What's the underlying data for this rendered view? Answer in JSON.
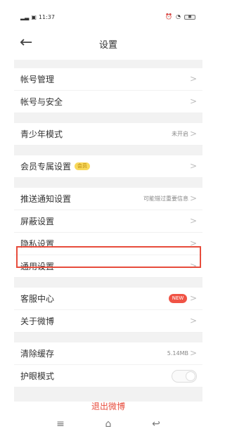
{
  "status_bar": {
    "time": "11:37",
    "signal_icon": "signal-icon",
    "sim_icon": "sim-icon",
    "alarm_icon": "alarm-icon",
    "wifi_icon": "wifi-icon",
    "battery_icon": "battery-icon"
  },
  "nav": {
    "back_label": "←",
    "title": "设置"
  },
  "groups": [
    {
      "items": [
        {
          "label": "帐号管理",
          "value": "",
          "chevron": ">"
        },
        {
          "label": "帐号与安全",
          "value": "",
          "chevron": ">"
        }
      ]
    },
    {
      "items": [
        {
          "label": "青少年模式",
          "value": "未开启",
          "chevron": ">"
        }
      ]
    },
    {
      "items": [
        {
          "label": "会员专属设置",
          "badge": "会员",
          "chevron": ">"
        }
      ]
    },
    {
      "items": [
        {
          "label": "推送通知设置",
          "value": "可能错过重要信息",
          "chevron": ">"
        },
        {
          "label": "屏蔽设置",
          "value": "",
          "chevron": ">"
        },
        {
          "label": "隐私设置",
          "value": "",
          "chevron": ">"
        },
        {
          "label": "通用设置",
          "value": "",
          "chevron": ">"
        }
      ]
    },
    {
      "items": [
        {
          "label": "客服中心",
          "badge": "NEW",
          "chevron": ">"
        },
        {
          "label": "关于微博",
          "value": "",
          "chevron": ">"
        }
      ]
    },
    {
      "items": [
        {
          "label": "清除缓存",
          "value": "5.14MB",
          "chevron": ">"
        },
        {
          "label": "护眼模式",
          "toggle": false
        }
      ]
    }
  ],
  "logout_label": "退出微博",
  "bottom_nav": {
    "menu_icon": "menu-icon",
    "home_icon": "home-icon",
    "back_icon": "back-icon"
  },
  "colors": {
    "accent": "#e74c3c",
    "gap": "#f2f2f2",
    "chevron": "#bcbcbc"
  }
}
